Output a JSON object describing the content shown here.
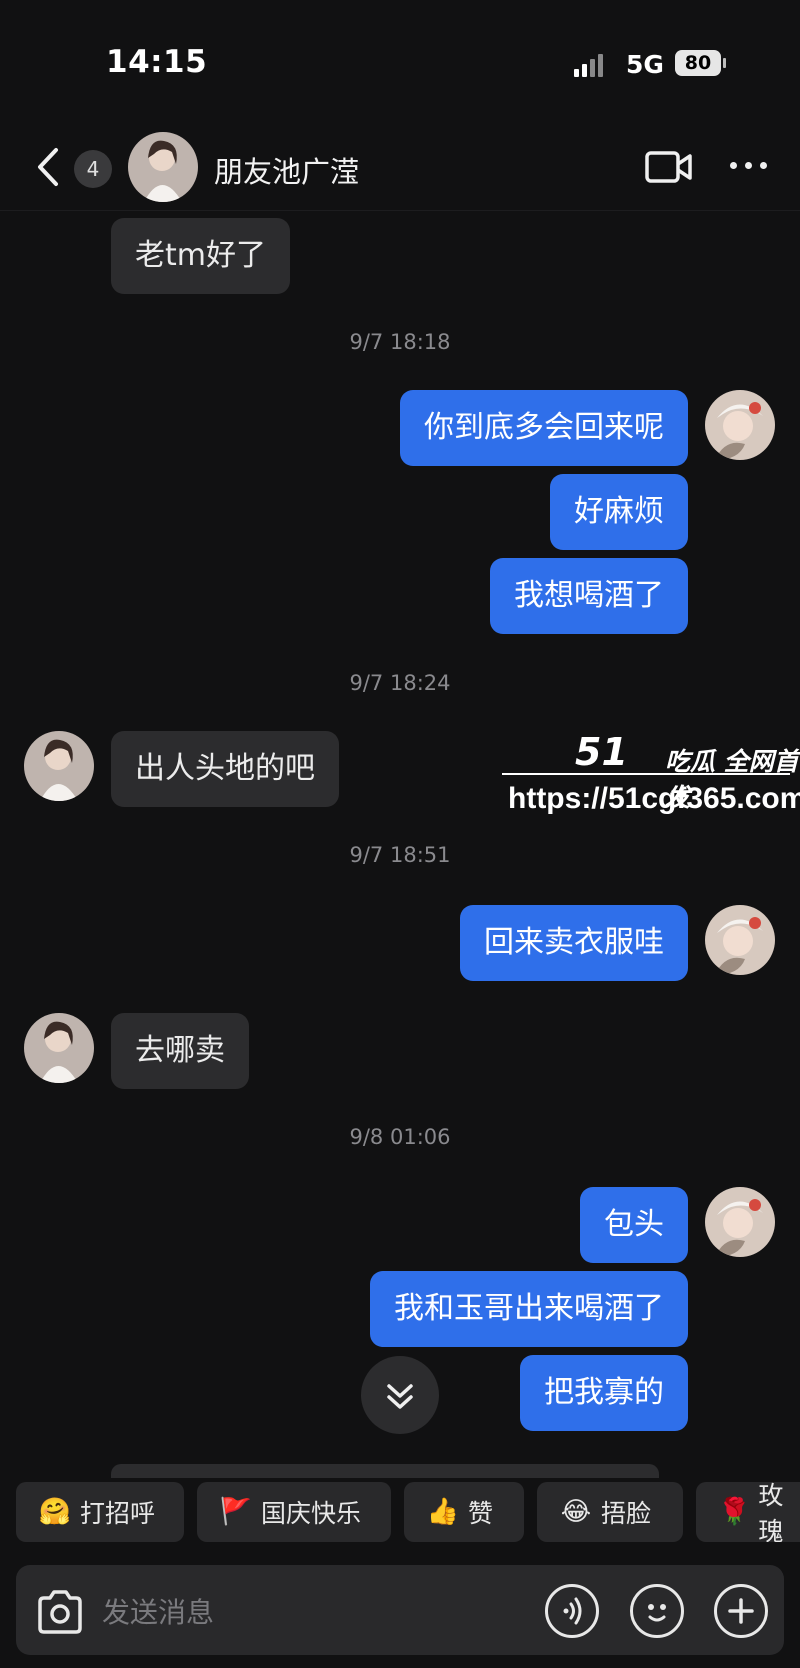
{
  "status_bar": {
    "time": "14:15",
    "network": "5G",
    "battery": "80"
  },
  "header": {
    "back_count": "4",
    "title": "朋友池广滢"
  },
  "messages": [
    {
      "text": "老tm好了"
    },
    {
      "text": "9/7 18:18"
    },
    {
      "text": "你到底多会回来呢"
    },
    {
      "text": "好麻烦"
    },
    {
      "text": "我想喝酒了"
    },
    {
      "text": "9/7 18:24"
    },
    {
      "text": "出人头地的吧"
    },
    {
      "text": "9/7 18:51"
    },
    {
      "text": "回来卖衣服哇"
    },
    {
      "text": "去哪卖"
    },
    {
      "text": "9/8 01:06"
    },
    {
      "text": "包头"
    },
    {
      "text": "我和玉哥出来喝酒了"
    },
    {
      "text": "把我寡的"
    }
  ],
  "watermark": {
    "logo": "51",
    "text": "吃瓜 全网首发",
    "url": "https://51cgf365.com"
  },
  "quick_replies": [
    {
      "emoji": "🤗",
      "label": "打招呼"
    },
    {
      "emoji": "🚩",
      "label": "国庆快乐"
    },
    {
      "emoji": "👍",
      "label": "赞"
    },
    {
      "emoji": "😂",
      "label": "捂脸"
    },
    {
      "emoji": "🌹",
      "label": "玫瑰"
    }
  ],
  "input": {
    "placeholder": "发送消息"
  },
  "colors": {
    "background": "#111112",
    "bubble_self": "#2f6fea",
    "bubble_other": "#2c2c2e"
  }
}
